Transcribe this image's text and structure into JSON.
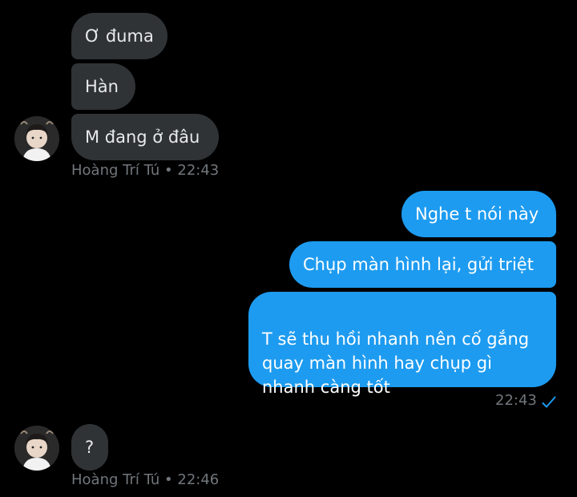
{
  "conversation": {
    "group1": {
      "messages": [
        "Ơ đuma",
        "Hàn",
        "M đang ở đâu"
      ],
      "sender": "Hoàng Trí Tú",
      "separator": "•",
      "time": "22:43"
    },
    "group2": {
      "messages": [
        "Nghe t nói này",
        "Chụp màn hình lại, gửi triệt",
        "T sẽ thu hồi nhanh nên cố gắng\nquay màn hình hay chụp gì\nnhanh càng tốt"
      ],
      "time": "22:43",
      "status_icon": "read-check-icon"
    },
    "group3": {
      "messages": [
        "?"
      ],
      "sender": "Hoàng Trí Tú",
      "separator": "•",
      "time": "22:46"
    }
  },
  "colors": {
    "background": "#000000",
    "incoming_bubble": "#2f3336",
    "outgoing_bubble": "#1d9bf0",
    "meta_text": "#71767b",
    "check": "#1d9bf0"
  }
}
